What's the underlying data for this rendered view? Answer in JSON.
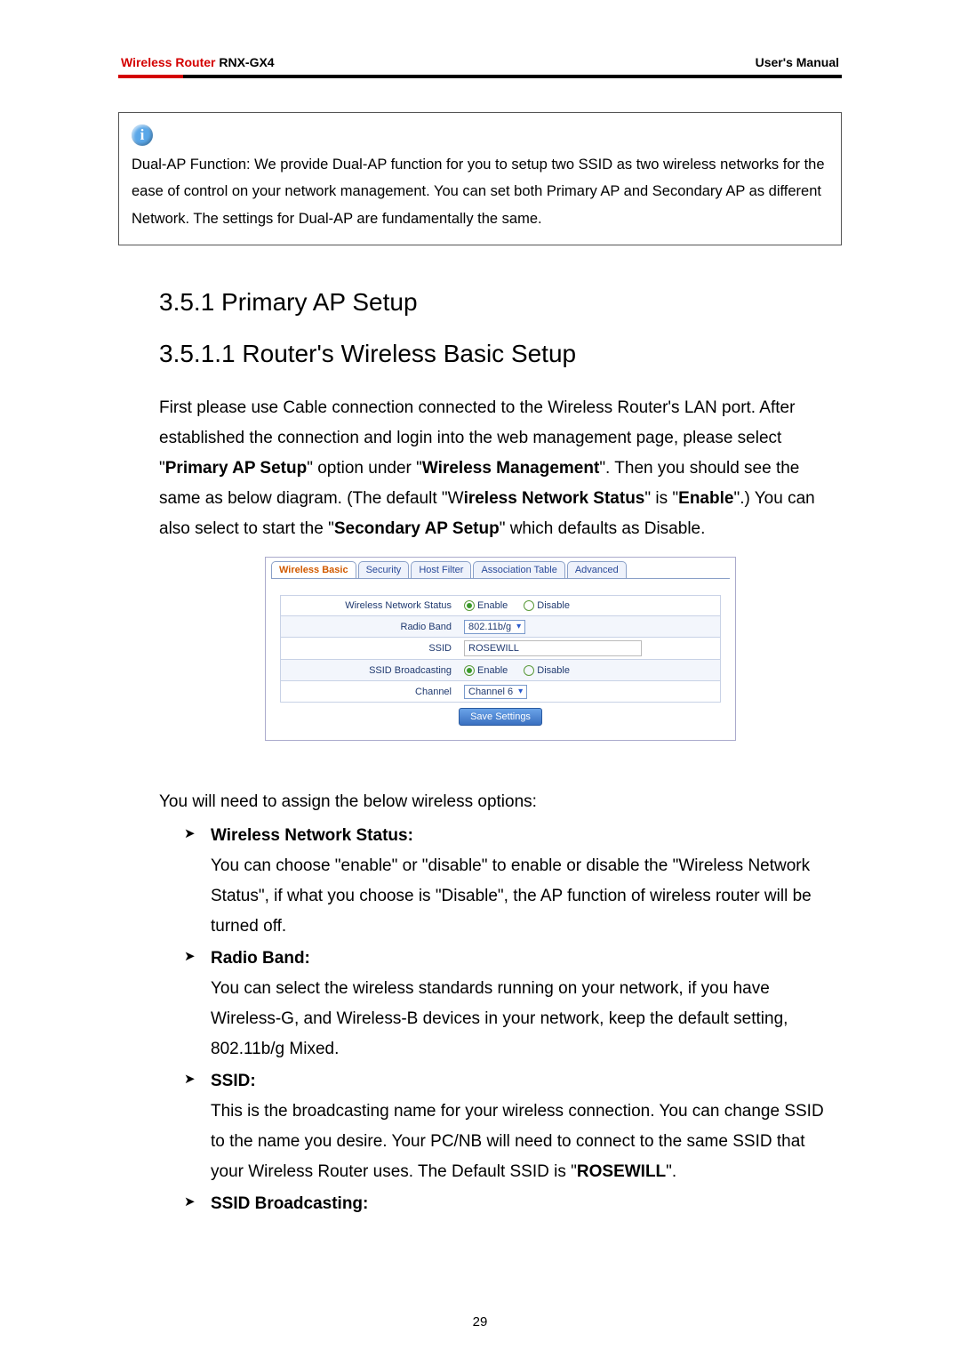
{
  "header": {
    "product_prefix": "Wireless Router",
    "product_model": "RNX-GX4",
    "right": "User's Manual"
  },
  "info_box": {
    "text": "Dual-AP Function: We provide Dual-AP function for you to setup two SSID as two wireless networks for the ease of control on your network management. You can set both Primary AP and Secondary AP as different Network. The settings for Dual-AP are fundamentally the same."
  },
  "headings": {
    "h2": "3.5.1 Primary AP Setup",
    "h3": "3.5.1.1 Router's Wireless Basic Setup"
  },
  "intro": {
    "p1a": "First please use Cable connection connected to the Wireless Router's LAN port. After established the connection and login into the web management page, please select \"",
    "p1b": "Primary AP Setup",
    "p1c": "\" option under \"",
    "p1d": "Wireless Management",
    "p1e": "\". Then you should see the same as below diagram. (The default \"W",
    "p1f": "ireless Network Status",
    "p1g": "\" is \"",
    "p1h": "Enable",
    "p1i": "\".) You can also select to start the \"",
    "p1j": "Secondary AP Setup",
    "p1k": "\" which defaults as Disable."
  },
  "ui": {
    "tabs": [
      "Wireless Basic",
      "Security",
      "Host Filter",
      "Association Table",
      "Advanced"
    ],
    "rows": {
      "wns_label": "Wireless Network Status",
      "enable": "Enable",
      "disable": "Disable",
      "radio_band_label": "Radio Band",
      "radio_band_value": "802.11b/g",
      "ssid_label": "SSID",
      "ssid_value": "ROSEWILL",
      "ssid_bcast_label": "SSID Broadcasting",
      "channel_label": "Channel",
      "channel_value": "Channel 6"
    },
    "save_btn": "Save Settings"
  },
  "post_intro": "You will need to assign the below wireless options:",
  "options": [
    {
      "title": "Wireless Network Status:",
      "body": "You can choose \"enable\" or \"disable\" to enable or disable the \"Wireless Network Status\", if what you choose is \"Disable\", the AP function of wireless router will be turned off."
    },
    {
      "title": "Radio Band:",
      "body": "You can select the wireless standards running on your network, if you have Wireless-G, and Wireless-B devices in your network, keep the default setting, 802.11b/g Mixed."
    },
    {
      "title": "SSID:",
      "body_a": "This is the broadcasting name for your wireless connection. You can change SSID to the name you desire. Your PC/NB will need to connect to the same SSID that your Wireless Router uses. The Default SSID is \"",
      "body_b": "ROSEWILL",
      "body_c": "\"."
    },
    {
      "title": "SSID Broadcasting:",
      "body": ""
    }
  ],
  "page_number": "29"
}
